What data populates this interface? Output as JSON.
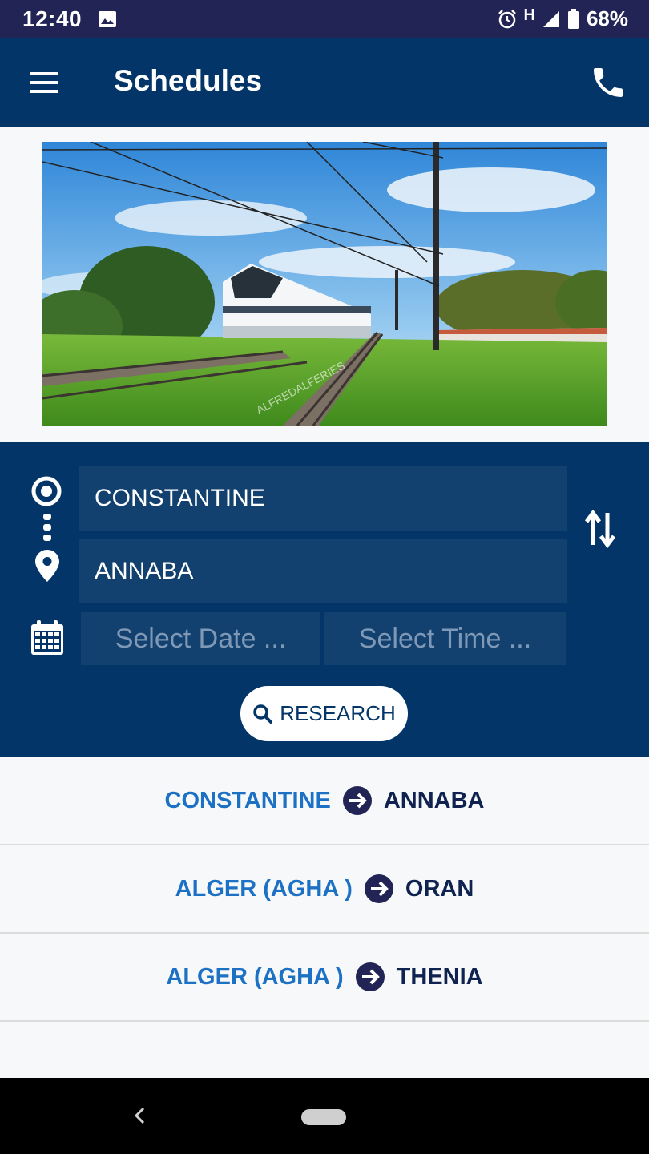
{
  "status_bar": {
    "time": "12:40",
    "network": "H",
    "battery": "68%"
  },
  "app_bar": {
    "title": "Schedules"
  },
  "search": {
    "origin": "CONSTANTINE",
    "destination": "ANNABA",
    "date_placeholder": "Select Date ...",
    "time_placeholder": "Select Time ...",
    "button_label": "RESEARCH"
  },
  "routes": [
    {
      "from": "CONSTANTINE",
      "to": "ANNABA"
    },
    {
      "from": "ALGER (AGHA )",
      "to": "ORAN"
    },
    {
      "from": "ALGER (AGHA )",
      "to": "THENIA"
    }
  ],
  "banner": {
    "watermark": "ALFREDALFERIES"
  },
  "colors": {
    "status_bar": "#212454",
    "primary": "#033568",
    "field": "#13416f",
    "route_from": "#1d71c4",
    "route_to": "#0f2250"
  }
}
